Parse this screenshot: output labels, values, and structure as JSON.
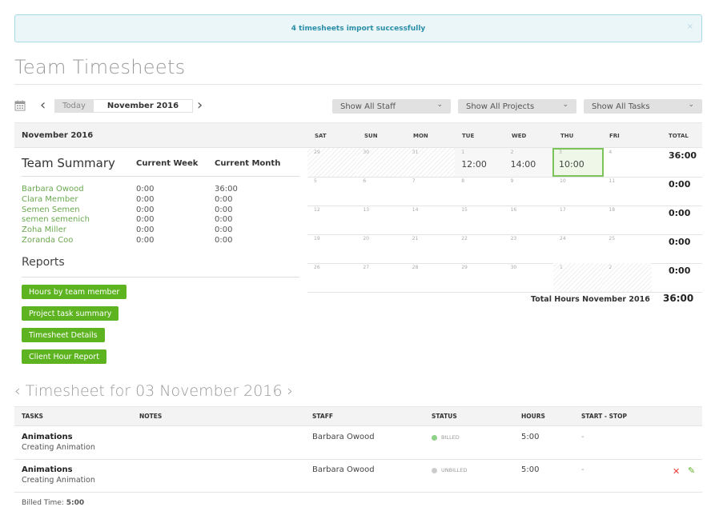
{
  "alert": {
    "message": "4 timesheets import successfully",
    "close_icon": "×"
  },
  "page_title": "Team Timesheets",
  "toolbar": {
    "calendar_icon": "calendar-icon",
    "prev": "‹",
    "today_label": "Today",
    "current_month": "November 2016",
    "next": "›",
    "filters": [
      {
        "label": "Show All Staff"
      },
      {
        "label": "Show All Projects"
      },
      {
        "label": "Show All Tasks"
      }
    ],
    "chevron": "⌄"
  },
  "left_panel": {
    "month_header": "November 2016",
    "team_summary": {
      "title": "Team Summary",
      "col_week": "Current Week",
      "col_month": "Current Month",
      "members": [
        {
          "name": "Barbara Owood",
          "week": "0:00",
          "month": "36:00"
        },
        {
          "name": "Clara Member",
          "week": "0:00",
          "month": "0:00"
        },
        {
          "name": "Semen Semen",
          "week": "0:00",
          "month": "0:00"
        },
        {
          "name": "semen semenich",
          "week": "0:00",
          "month": "0:00"
        },
        {
          "name": "Zoha Miller",
          "week": "0:00",
          "month": "0:00"
        },
        {
          "name": "Zoranda Coo",
          "week": "0:00",
          "month": "0:00"
        }
      ]
    },
    "reports": {
      "title": "Reports",
      "buttons": [
        {
          "label": "Hours by team member"
        },
        {
          "label": "Project task summary"
        },
        {
          "label": "Timesheet Details"
        },
        {
          "label": "Client Hour Report"
        }
      ]
    }
  },
  "calendar": {
    "days_of_week": [
      "SAT",
      "SUN",
      "MON",
      "TUE",
      "WED",
      "THU",
      "FRI"
    ],
    "total_label": "TOTAL",
    "weeks": [
      {
        "total": "36:00",
        "days": [
          {
            "num": "29",
            "hours": "",
            "state": "outside"
          },
          {
            "num": "30",
            "hours": "",
            "state": "outside"
          },
          {
            "num": "31",
            "hours": "",
            "state": "outside"
          },
          {
            "num": "1",
            "hours": "12:00",
            "state": "has-hours"
          },
          {
            "num": "2",
            "hours": "14:00",
            "state": "has-hours"
          },
          {
            "num": "3",
            "hours": "10:00",
            "state": "selected"
          },
          {
            "num": "4",
            "hours": "",
            "state": "normal"
          }
        ]
      },
      {
        "total": "0:00",
        "days": [
          {
            "num": "5",
            "hours": "",
            "state": "normal"
          },
          {
            "num": "6",
            "hours": "",
            "state": "normal"
          },
          {
            "num": "7",
            "hours": "",
            "state": "normal"
          },
          {
            "num": "8",
            "hours": "",
            "state": "normal"
          },
          {
            "num": "9",
            "hours": "",
            "state": "normal"
          },
          {
            "num": "10",
            "hours": "",
            "state": "normal"
          },
          {
            "num": "11",
            "hours": "",
            "state": "normal"
          }
        ]
      },
      {
        "total": "0:00",
        "days": [
          {
            "num": "12",
            "hours": "",
            "state": "normal"
          },
          {
            "num": "13",
            "hours": "",
            "state": "normal"
          },
          {
            "num": "14",
            "hours": "",
            "state": "normal"
          },
          {
            "num": "15",
            "hours": "",
            "state": "normal"
          },
          {
            "num": "16",
            "hours": "",
            "state": "normal"
          },
          {
            "num": "17",
            "hours": "",
            "state": "normal"
          },
          {
            "num": "18",
            "hours": "",
            "state": "normal"
          }
        ]
      },
      {
        "total": "0:00",
        "days": [
          {
            "num": "19",
            "hours": "",
            "state": "normal"
          },
          {
            "num": "20",
            "hours": "",
            "state": "normal"
          },
          {
            "num": "21",
            "hours": "",
            "state": "normal"
          },
          {
            "num": "22",
            "hours": "",
            "state": "normal"
          },
          {
            "num": "23",
            "hours": "",
            "state": "normal"
          },
          {
            "num": "24",
            "hours": "",
            "state": "normal"
          },
          {
            "num": "25",
            "hours": "",
            "state": "normal"
          }
        ]
      },
      {
        "total": "0:00",
        "days": [
          {
            "num": "26",
            "hours": "",
            "state": "normal"
          },
          {
            "num": "27",
            "hours": "",
            "state": "normal"
          },
          {
            "num": "28",
            "hours": "",
            "state": "normal"
          },
          {
            "num": "29",
            "hours": "",
            "state": "normal"
          },
          {
            "num": "30",
            "hours": "",
            "state": "normal"
          },
          {
            "num": "1",
            "hours": "",
            "state": "outside"
          },
          {
            "num": "2",
            "hours": "",
            "state": "outside"
          }
        ]
      }
    ],
    "grand_total_label": "Total Hours November 2016",
    "grand_total": "36:00"
  },
  "day_timesheet": {
    "prev": "‹",
    "title": "Timesheet for 03 November 2016",
    "next": "›",
    "columns": [
      "TASKS",
      "NOTES",
      "STAFF",
      "STATUS",
      "HOURS",
      "START - STOP"
    ],
    "rows": [
      {
        "task": "Animations",
        "subtask": "Creating Animation",
        "notes": "",
        "staff": "Barbara Owood",
        "status": "BILLED",
        "status_color": "#8fd18a",
        "hours": "5:00",
        "start_stop": "-",
        "actions": false
      },
      {
        "task": "Animations",
        "subtask": "Creating Animation",
        "notes": "",
        "staff": "Barbara Owood",
        "status": "UNBILLED",
        "status_color": "#cccccc",
        "hours": "5:00",
        "start_stop": "-",
        "actions": true
      }
    ],
    "delete_icon": "✕",
    "edit_icon": "✎",
    "billed_time_label": "Billed Time:",
    "billed_time_value": "5:00"
  },
  "colors": {
    "accent_green": "#5db320",
    "member_link": "#6aa84f",
    "alert_text": "#2a8ea8",
    "delete_red": "#e53935"
  }
}
